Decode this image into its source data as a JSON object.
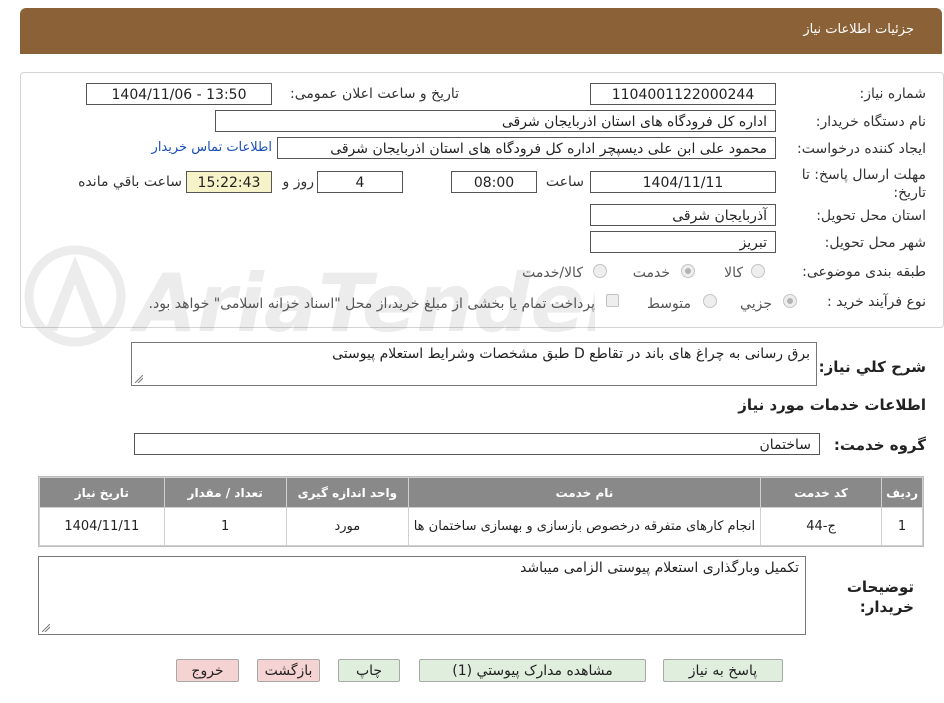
{
  "header": {
    "title": "جزئیات اطلاعات نیاز"
  },
  "form": {
    "need_number": {
      "label": "شماره نیاز:",
      "value": "1104001122000244"
    },
    "announce_datetime": {
      "label": "تاریخ و ساعت اعلان عمومی:",
      "value": "1404/11/06 - 13:50"
    },
    "buyer_org": {
      "label": "نام دستگاه خریدار:",
      "value": "اداره کل فرودگاه های استان اذربایجان شرقی"
    },
    "requester": {
      "label": "ایجاد کننده درخواست:",
      "value": "محمود علی ابن علی دیسپچر اداره کل فرودگاه های استان اذربایجان شرقی"
    },
    "buyer_contact_link": "اطلاعات تماس خریدار",
    "deadline": {
      "label": "مهلت ارسال پاسخ: تا تاریخ:",
      "date": "1404/11/11",
      "time_label": "ساعت",
      "time": "08:00",
      "days": "4",
      "days_label": "روز و",
      "remaining": "15:22:43",
      "remaining_label": "ساعت باقي مانده"
    },
    "delivery_province": {
      "label": "استان محل تحویل:",
      "value": "آذربایجان شرقی"
    },
    "delivery_city": {
      "label": "شهر محل تحویل:",
      "value": "تبریز"
    },
    "category": {
      "label": "طبقه بندی موضوعی:",
      "options": [
        "کالا",
        "خدمت",
        "کالا/خدمت"
      ],
      "selected": "خدمت"
    },
    "process_type": {
      "label": "نوع فرآیند خرید :",
      "options": [
        "جزیي",
        "متوسط"
      ],
      "selected": "جزیي",
      "payment_note": "پرداخت تمام یا بخشی از مبلغ خرید،از محل \"اسناد خزانه اسلامی\" خواهد بود."
    }
  },
  "description": {
    "label": "شرح کلي نياز:",
    "value": "برق رسانی به چراغ های باند در تقاطع D طبق مشخصات وشرایط استعلام پیوستی"
  },
  "services_section": {
    "title": "اطلاعات خدمات مورد نياز",
    "group_label": "گروه خدمت:",
    "group_value": "ساختمان"
  },
  "services_table": {
    "headers": [
      "رديف",
      "کد خدمت",
      "نام خدمت",
      "واحد اندازه گيری",
      "تعداد / مقدار",
      "تاريخ نياز"
    ],
    "rows": [
      [
        "1",
        "ج-44",
        "انجام کارهای متفرقه درخصوص بازسازی و بهسازی ساختمان ها",
        "مورد",
        "1",
        "1404/11/11"
      ]
    ]
  },
  "buyer_notes": {
    "label": "توضیحات خریدار:",
    "value": "تکمیل وبارگذاری استعلام پیوستی الزامی میباشد"
  },
  "buttons": {
    "reply": "پاسخ به نیاز",
    "attachments": "مشاهده مدارک پیوستي (1)",
    "print": "چاپ",
    "back": "بازگشت",
    "exit": "خروج"
  },
  "watermark": {
    "text": "AriaTender.neT"
  },
  "colors": {
    "header": "#8b6237",
    "button_green": "#dfeedd",
    "button_pink": "#f6d3d3",
    "table_header": "#898989"
  }
}
